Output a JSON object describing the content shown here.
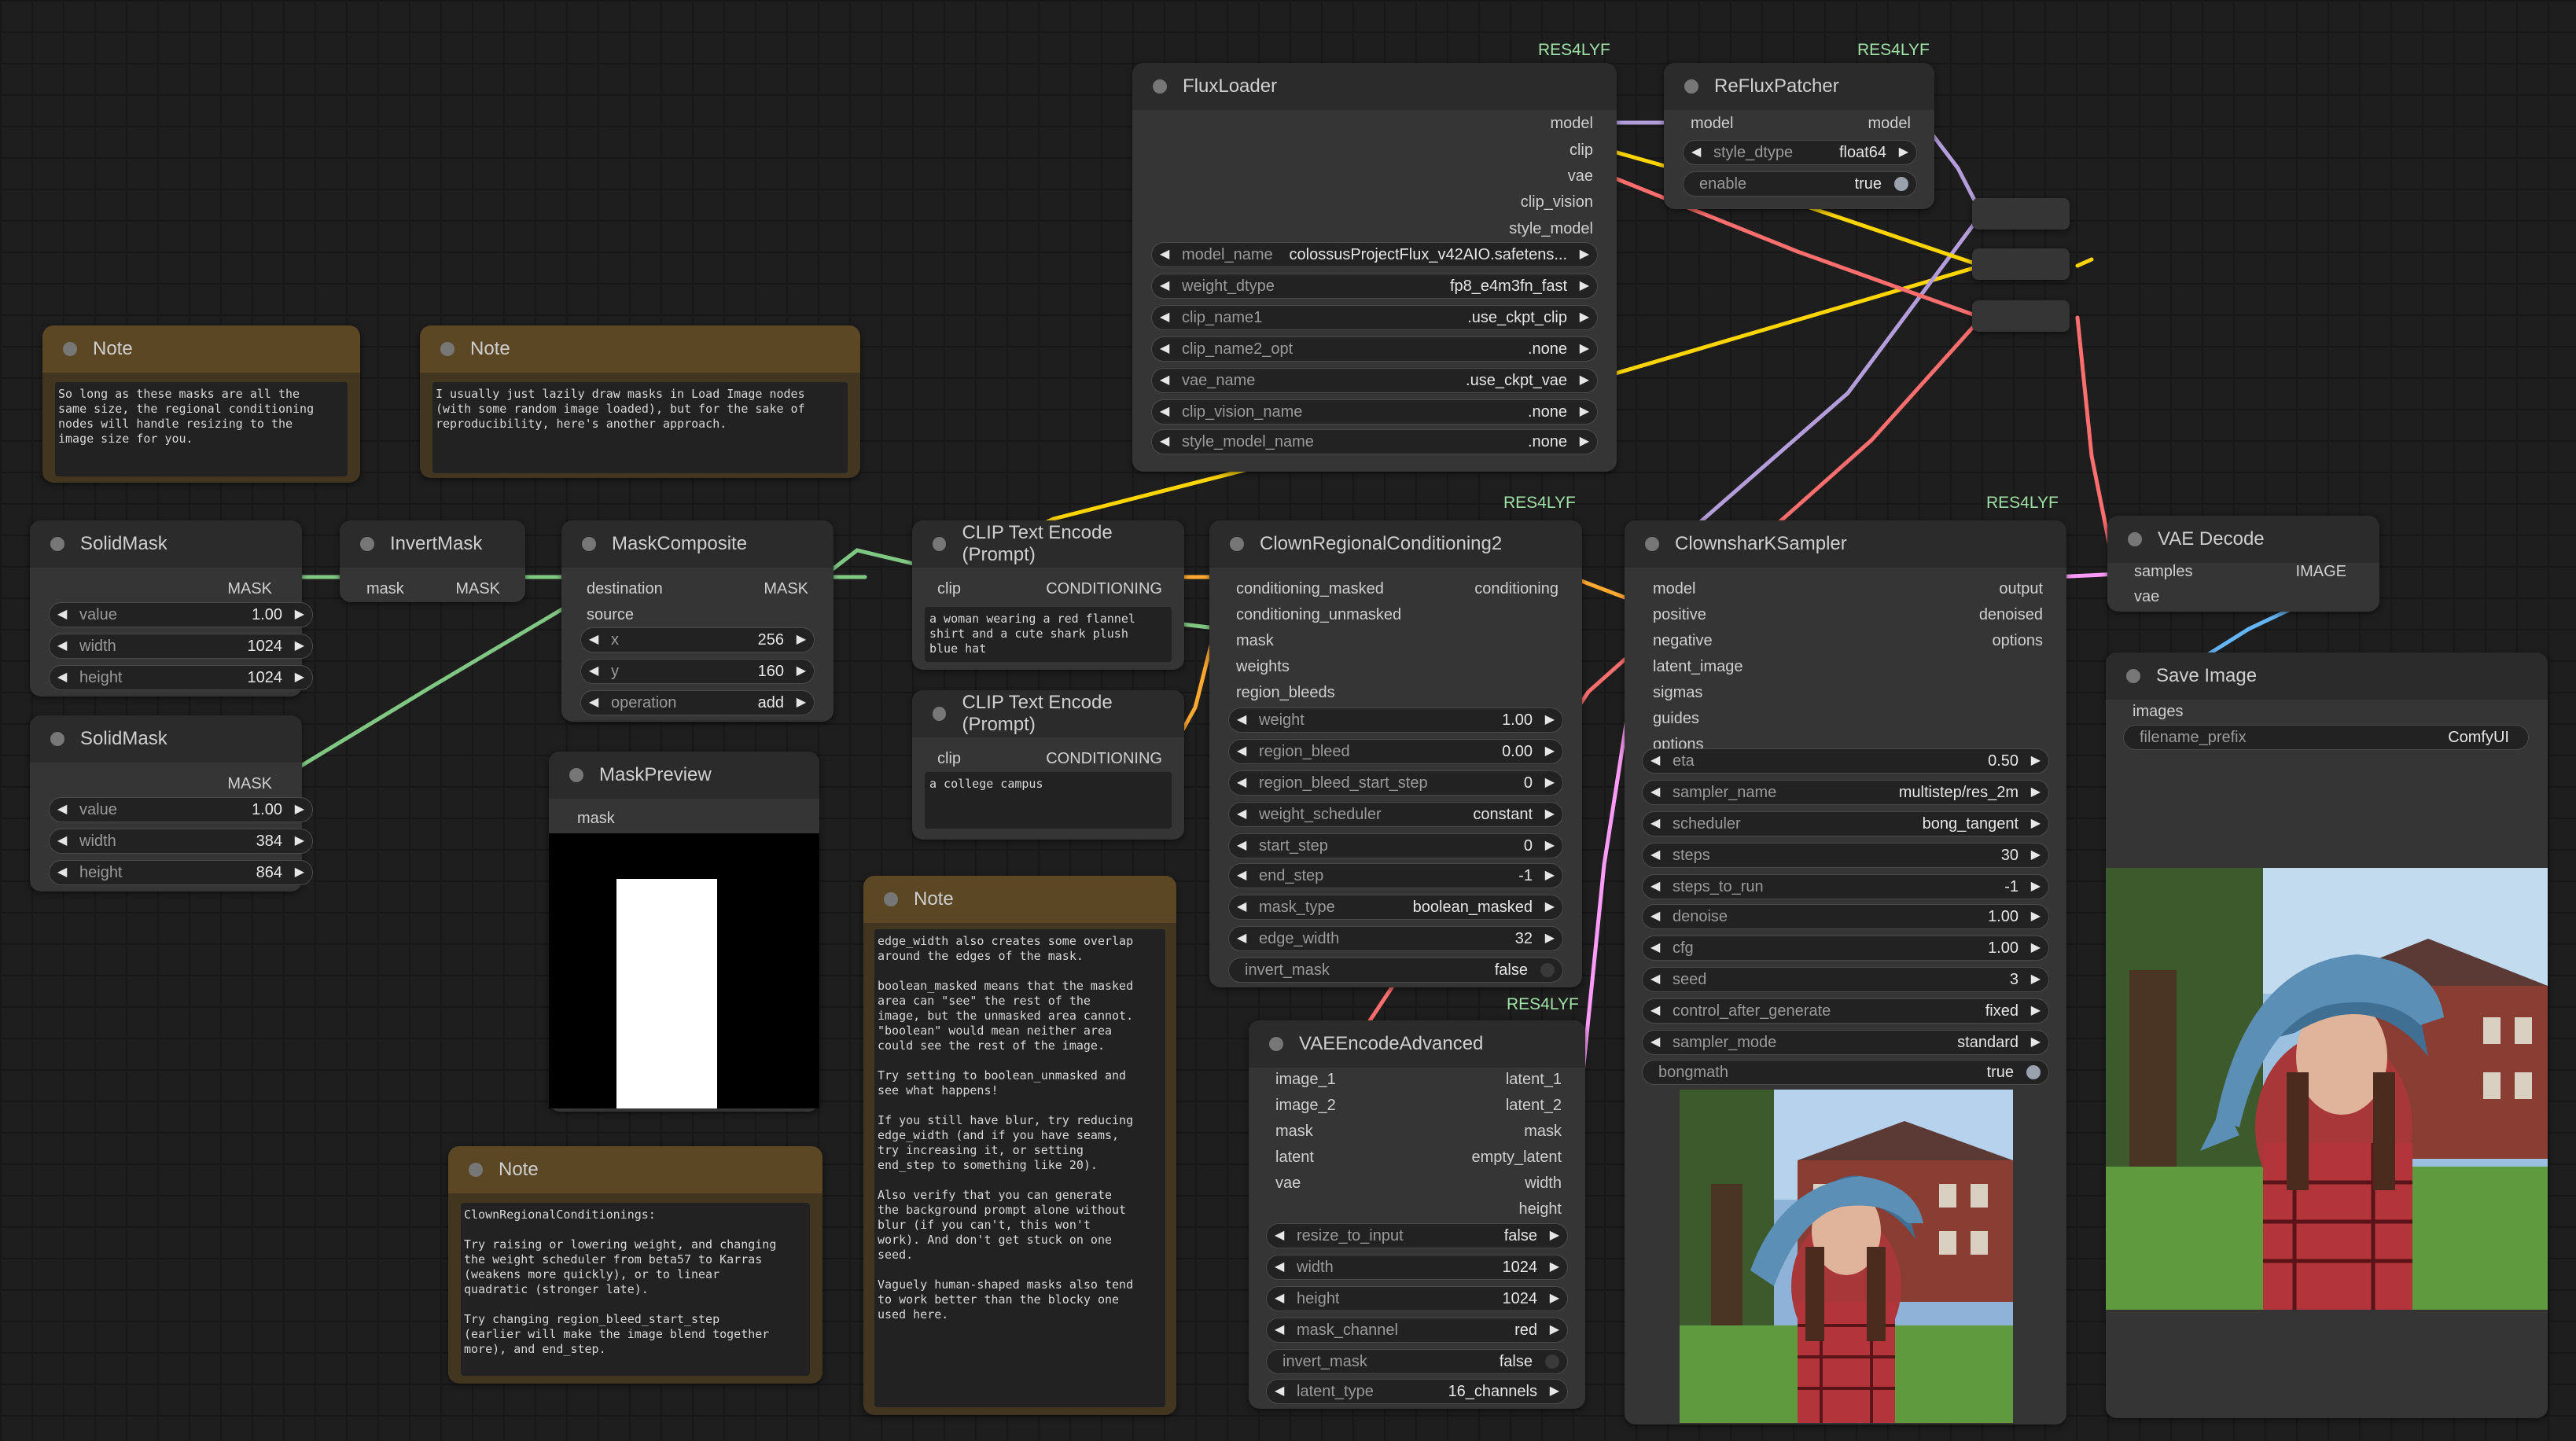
{
  "tags": {
    "res4lyf": "RES4LYF"
  },
  "colors": {
    "model": "#b39ddb",
    "clip": "#ffd500",
    "vae": "#ff6e6e",
    "clip_vision": "#a8dadc",
    "style_model": "#c2ffae",
    "mask": "#81c784",
    "conditioning": "#ffa931",
    "latent": "#ff9cf9",
    "image": "#64b5f6",
    "sigmas": "#cdffcd",
    "guides": "#888888",
    "options": "#888888"
  },
  "notes": {
    "note1": {
      "title": "Note",
      "text": "So long as these masks are all the\nsame size, the regional conditioning\nnodes will handle resizing to the\nimage size for you."
    },
    "note2": {
      "title": "Note",
      "text": "I usually just lazily draw masks in Load Image nodes\n(with some random image loaded), but for the sake of\nreproducibility, here's another approach."
    },
    "note3": {
      "title": "Note",
      "text": "ClownRegionalConditionings:\n\nTry raising or lowering weight, and changing\nthe weight scheduler from beta57 to Karras\n(weakens more quickly), or to linear\nquadratic (stronger late).\n\nTry changing region_bleed_start_step\n(earlier will make the image blend together\nmore), and end_step."
    },
    "note4": {
      "title": "Note",
      "text": "edge_width also creates some overlap\naround the edges of the mask.\n\nboolean_masked means that the masked\narea can \"see\" the rest of the\nimage, but the unmasked area cannot.\n\"boolean\" would mean neither area\ncould see the rest of the image.\n\nTry setting to boolean_unmasked and\nsee what happens!\n\nIf you still have blur, try reducing\nedge_width (and if you have seams,\ntry increasing it, or setting\nend_step to something like 20).\n\nAlso verify that you can generate\nthe background prompt alone without\nblur (if you can't, this won't\nwork). And don't get stuck on one\nseed.\n\nVaguely human-shaped masks also tend\nto work better than the blocky one\nused here."
    }
  },
  "solidmask1": {
    "title": "SolidMask",
    "out": "MASK",
    "w": [
      {
        "label": "value",
        "value": "1.00"
      },
      {
        "label": "width",
        "value": "1024"
      },
      {
        "label": "height",
        "value": "1024"
      }
    ]
  },
  "solidmask2": {
    "title": "SolidMask",
    "out": "MASK",
    "w": [
      {
        "label": "value",
        "value": "1.00"
      },
      {
        "label": "width",
        "value": "384"
      },
      {
        "label": "height",
        "value": "864"
      }
    ]
  },
  "invertmask": {
    "title": "InvertMask",
    "in": "mask",
    "out": "MASK"
  },
  "maskcomposite": {
    "title": "MaskComposite",
    "in": [
      "destination",
      "source"
    ],
    "out": "MASK",
    "w": [
      {
        "label": "x",
        "value": "256"
      },
      {
        "label": "y",
        "value": "160"
      },
      {
        "label": "operation",
        "value": "add"
      }
    ]
  },
  "maskpreview": {
    "title": "MaskPreview",
    "in": "mask"
  },
  "clip1": {
    "title": "CLIP Text Encode (Prompt)",
    "in": "clip",
    "out": "CONDITIONING",
    "text": "a woman wearing a red flannel\nshirt and a cute shark plush\nblue hat"
  },
  "clip2": {
    "title": "CLIP Text Encode (Prompt)",
    "in": "clip",
    "out": "CONDITIONING",
    "text": "a college campus"
  },
  "fluxloader": {
    "title": "FluxLoader",
    "outs": [
      "model",
      "clip",
      "vae",
      "clip_vision",
      "style_model"
    ],
    "w": [
      {
        "label": "model_name",
        "value": "colossusProjectFlux_v42AIO.safetens..."
      },
      {
        "label": "weight_dtype",
        "value": "fp8_e4m3fn_fast"
      },
      {
        "label": "clip_name1",
        "value": ".use_ckpt_clip"
      },
      {
        "label": "clip_name2_opt",
        "value": ".none"
      },
      {
        "label": "vae_name",
        "value": ".use_ckpt_vae"
      },
      {
        "label": "clip_vision_name",
        "value": ".none"
      },
      {
        "label": "style_model_name",
        "value": ".none"
      }
    ]
  },
  "reflux": {
    "title": "ReFluxPatcher",
    "in": "model",
    "out": "model",
    "w": [
      {
        "label": "style_dtype",
        "value": "float64"
      }
    ],
    "toggle": {
      "label": "enable",
      "value": "true"
    }
  },
  "crc": {
    "title": "ClownRegionalConditioning2",
    "ins": [
      "conditioning_masked",
      "conditioning_unmasked",
      "mask",
      "weights",
      "region_bleeds"
    ],
    "out": "conditioning",
    "w": [
      {
        "label": "weight",
        "value": "1.00"
      },
      {
        "label": "region_bleed",
        "value": "0.00"
      },
      {
        "label": "region_bleed_start_step",
        "value": "0"
      },
      {
        "label": "weight_scheduler",
        "value": "constant"
      },
      {
        "label": "start_step",
        "value": "0"
      },
      {
        "label": "end_step",
        "value": "-1"
      },
      {
        "label": "mask_type",
        "value": "boolean_masked"
      },
      {
        "label": "edge_width",
        "value": "32"
      }
    ],
    "toggle": {
      "label": "invert_mask",
      "value": "false"
    }
  },
  "vaeenc": {
    "title": "VAEEncodeAdvanced",
    "ins": [
      "image_1",
      "image_2",
      "mask",
      "latent",
      "vae"
    ],
    "outs": [
      "latent_1",
      "latent_2",
      "mask",
      "empty_latent",
      "width",
      "height"
    ],
    "w": [
      {
        "label": "resize_to_input",
        "value": "false",
        "toggle": true
      },
      {
        "label": "width",
        "value": "1024"
      },
      {
        "label": "height",
        "value": "1024"
      },
      {
        "label": "mask_channel",
        "value": "red"
      },
      {
        "label": "invert_mask",
        "value": "false",
        "toggle": true
      },
      {
        "label": "latent_type",
        "value": "16_channels"
      }
    ]
  },
  "sampler": {
    "title": "ClownsharKSampler",
    "ins": [
      "model",
      "positive",
      "negative",
      "latent_image",
      "sigmas",
      "guides",
      "options"
    ],
    "outs": [
      "output",
      "denoised",
      "options"
    ],
    "w": [
      {
        "label": "eta",
        "value": "0.50"
      },
      {
        "label": "sampler_name",
        "value": "multistep/res_2m"
      },
      {
        "label": "scheduler",
        "value": "bong_tangent"
      },
      {
        "label": "steps",
        "value": "30"
      },
      {
        "label": "steps_to_run",
        "value": "-1"
      },
      {
        "label": "denoise",
        "value": "1.00"
      },
      {
        "label": "cfg",
        "value": "1.00"
      },
      {
        "label": "seed",
        "value": "3"
      },
      {
        "label": "control_after_generate",
        "value": "fixed"
      },
      {
        "label": "sampler_mode",
        "value": "standard"
      }
    ],
    "toggle": {
      "label": "bongmath",
      "value": "true"
    }
  },
  "vaedecode": {
    "title": "VAE Decode",
    "ins": [
      "samples",
      "vae"
    ],
    "out": "IMAGE"
  },
  "saveimage": {
    "title": "Save Image",
    "in": "images",
    "w": [
      {
        "label": "filename_prefix",
        "value": "ComfyUI"
      }
    ]
  }
}
